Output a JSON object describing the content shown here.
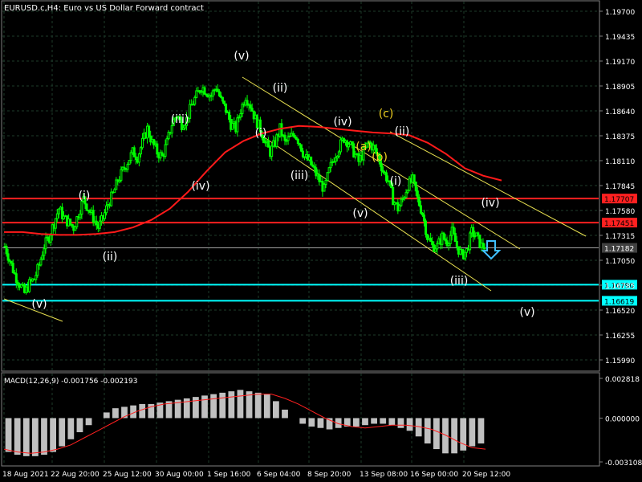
{
  "header": {
    "symbol_title": "EURUSD.c,H4:  Euro vs US Dollar Forward contract"
  },
  "colors": {
    "background": "#000000",
    "grid": "#1e3b2a",
    "candle": "#00ff00",
    "ma": "#ff1a1a",
    "resistance": "#ff2020",
    "support": "#00ffff",
    "current": "#a0a0a0",
    "channel": "#e8e050",
    "wave_white": "#ffffff",
    "wave_yellow": "#f0d020",
    "arrow": "#40c0ff",
    "macd_hist": "#c0c0c0",
    "macd_signal": "#ff2020",
    "axis_text": "#ffffff"
  },
  "chart_data": {
    "type": "candlestick",
    "symbol": "EURUSD.c",
    "timeframe": "H4",
    "y_ticks": [
      "1.19700",
      "1.19435",
      "1.19170",
      "1.18905",
      "1.18640",
      "1.18375",
      "1.18110",
      "1.17845",
      "1.17580",
      "1.17315",
      "1.17050",
      "1.16785",
      "1.16520",
      "1.16255",
      "1.15990"
    ],
    "x_ticks": [
      "18 Aug 2021",
      "22 Aug 20:00",
      "25 Aug 12:00",
      "30 Aug 00:00",
      "1 Sep 16:00",
      "6 Sep 04:00",
      "8 Sep 20:00",
      "13 Sep 08:00",
      "16 Sep 00:00",
      "20 Sep 12:00"
    ],
    "levels": [
      {
        "name": "resistance-1",
        "price": 1.17707,
        "label": "1.17707",
        "color": "#ff2020"
      },
      {
        "name": "resistance-2",
        "price": 1.17451,
        "label": "1.17451",
        "color": "#ff2020"
      },
      {
        "name": "current-price",
        "price": 1.17182,
        "label": "1.17182",
        "color": "#a0a0a0"
      },
      {
        "name": "support-1",
        "price": 1.1679,
        "label": "1.16790",
        "color": "#00ffff"
      },
      {
        "name": "support-2",
        "price": 1.16619,
        "label": "1.16619",
        "color": "#00ffff"
      }
    ],
    "close_path": [
      1.172,
      1.1705,
      1.169,
      1.168,
      1.167,
      1.168,
      1.1685,
      1.17,
      1.172,
      1.173,
      1.1745,
      1.176,
      1.175,
      1.1745,
      1.174,
      1.1755,
      1.177,
      1.176,
      1.175,
      1.174,
      1.175,
      1.1765,
      1.1775,
      1.179,
      1.18,
      1.181,
      1.182,
      1.1815,
      1.183,
      1.1845,
      1.183,
      1.182,
      1.1815,
      1.183,
      1.185,
      1.186,
      1.185,
      1.1855,
      1.187,
      1.188,
      1.189,
      1.1885,
      1.188,
      1.189,
      1.1875,
      1.1865,
      1.185,
      1.1845,
      1.1865,
      1.188,
      1.187,
      1.1855,
      1.1845,
      1.183,
      1.182,
      1.183,
      1.1845,
      1.183,
      1.1835,
      1.184,
      1.183,
      1.1815,
      1.181,
      1.18,
      1.179,
      1.178,
      1.18,
      1.1815,
      1.1825,
      1.1835,
      1.183,
      1.182,
      1.181,
      1.182,
      1.183,
      1.1825,
      1.1815,
      1.18,
      1.179,
      1.177,
      1.176,
      1.177,
      1.1785,
      1.179,
      1.177,
      1.1755,
      1.173,
      1.172,
      1.172,
      1.173,
      1.1725,
      1.1735,
      1.172,
      1.171,
      1.1715,
      1.1735,
      1.173,
      1.172
    ],
    "ma_path": [
      1.1735,
      1.1735,
      1.1733,
      1.1732,
      1.1732,
      1.1733,
      1.1735,
      1.174,
      1.1748,
      1.176,
      1.1778,
      1.18,
      1.182,
      1.1832,
      1.184,
      1.1845,
      1.1848,
      1.1847,
      1.1845,
      1.1843,
      1.1841,
      1.184,
      1.1838,
      1.183,
      1.1818,
      1.1803,
      1.1795,
      1.179
    ],
    "macd": {
      "label": "MACD(12,26,9) -0.001756 -0.002193",
      "y_ticks": [
        "0.002818",
        "0.000000",
        "-0.003108"
      ],
      "hist": [
        -0.0024,
        -0.0026,
        -0.0027,
        -0.0027,
        -0.0026,
        -0.0024,
        -0.002,
        -0.0015,
        -0.001,
        -0.0005,
        0.0,
        0.0004,
        0.0007,
        0.0008,
        0.0009,
        0.001,
        0.001,
        0.0011,
        0.0012,
        0.0013,
        0.0014,
        0.0015,
        0.0016,
        0.0017,
        0.0018,
        0.0019,
        0.002,
        0.0019,
        0.0018,
        0.0017,
        0.0012,
        0.0006,
        0.0,
        -0.0004,
        -0.0006,
        -0.0007,
        -0.0008,
        -0.0007,
        -0.0006,
        -0.0006,
        -0.0005,
        -0.0004,
        -0.0004,
        -0.0005,
        -0.0007,
        -0.0009,
        -0.0013,
        -0.0018,
        -0.0022,
        -0.0025,
        -0.0025,
        -0.0023,
        -0.002,
        -0.0018
      ],
      "signal": [
        -0.0022,
        -0.0024,
        -0.0025,
        -0.0024,
        -0.0022,
        -0.0019,
        -0.0014,
        -0.0009,
        -0.0004,
        0.0001,
        0.0005,
        0.0008,
        0.001,
        0.0011,
        0.0012,
        0.0013,
        0.0014,
        0.0015,
        0.0016,
        0.0017,
        0.0017,
        0.0014,
        0.001,
        0.0005,
        0.0,
        -0.0004,
        -0.0006,
        -0.0007,
        -0.0006,
        -0.0005,
        -0.0005,
        -0.0006,
        -0.0008,
        -0.0012,
        -0.0017,
        -0.0021,
        -0.0022
      ]
    }
  },
  "waves": [
    {
      "text": "(v)",
      "color": "white",
      "ref": "low-start"
    },
    {
      "text": "(i)",
      "color": "white",
      "ref": "i-1"
    },
    {
      "text": "(ii)",
      "color": "white",
      "ref": "ii-1"
    },
    {
      "text": "(iii)",
      "color": "white",
      "ref": "iii-1"
    },
    {
      "text": "(iv)",
      "color": "white",
      "ref": "iv-1"
    },
    {
      "text": "(v)",
      "color": "white",
      "ref": "v-top"
    },
    {
      "text": "(i)",
      "color": "white",
      "ref": "i-2"
    },
    {
      "text": "(ii)",
      "color": "white",
      "ref": "ii-2"
    },
    {
      "text": "(iii)",
      "color": "white",
      "ref": "iii-2"
    },
    {
      "text": "(iv)",
      "color": "white",
      "ref": "iv-2"
    },
    {
      "text": "(v)",
      "color": "white",
      "ref": "v-2"
    },
    {
      "text": "(a)",
      "color": "yellow",
      "ref": "a"
    },
    {
      "text": "(b)",
      "color": "yellow",
      "ref": "b"
    },
    {
      "text": "(c)",
      "color": "yellow",
      "ref": "c"
    },
    {
      "text": "(i)",
      "color": "white",
      "ref": "i-3"
    },
    {
      "text": "(ii)",
      "color": "white",
      "ref": "ii-3"
    },
    {
      "text": "(iii)",
      "color": "white",
      "ref": "iii-3"
    },
    {
      "text": "(iv)",
      "color": "white",
      "ref": "iv-3"
    },
    {
      "text": "(v)",
      "color": "white",
      "ref": "v-3"
    }
  ]
}
